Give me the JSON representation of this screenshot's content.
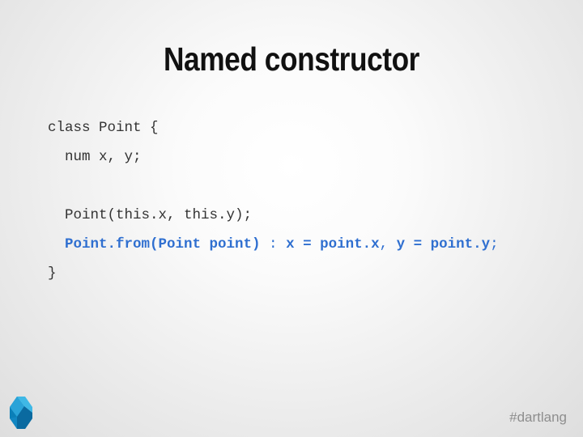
{
  "slide": {
    "title": "Named constructor",
    "code_lines": [
      "class Point {",
      "  num x, y;",
      "",
      "  Point(this.x, this.y);",
      "  Point.from(Point point) : x = point.x, y = point.y;",
      "}"
    ],
    "highlight_parts": [
      {
        "text": "  Point.from(Point point) ",
        "bold": true
      },
      {
        "text": ":",
        "bold": false
      },
      {
        "text": " x = point.x",
        "bold": true
      },
      {
        "text": ",",
        "bold": false
      },
      {
        "text": " y = point.y",
        "bold": true
      },
      {
        "text": ";",
        "bold": false
      }
    ],
    "hashtag": "#dartlang",
    "logo_icon": "dart-logo-icon",
    "colors": {
      "highlight": "#2f6fd0",
      "code": "#333333",
      "title": "#111111",
      "hashtag": "#8e8e8e"
    }
  }
}
